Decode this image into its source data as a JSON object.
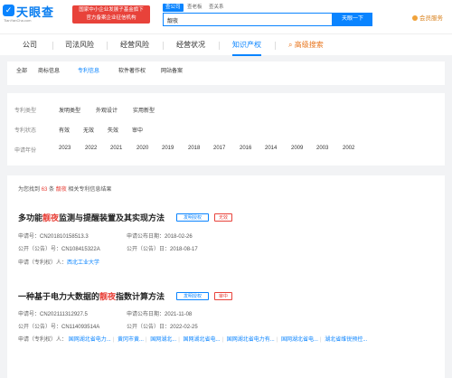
{
  "header": {
    "logo_text": "天眼查",
    "logo_sub": "TianYanCha.com",
    "gov_badge_line1": "国家中小企业发展子基金旗下",
    "gov_badge_line2": "官方备案企业征信机构",
    "search_tabs": [
      "查公司",
      "查老板",
      "查关系"
    ],
    "search_value": "靓夜",
    "search_button": "天眼一下",
    "vip_label": "会员服务"
  },
  "main_nav": {
    "items": [
      "公司",
      "司法风险",
      "经营风险",
      "经营状况",
      "知识产权",
      "高级搜索"
    ]
  },
  "sub_tabs": [
    "全部",
    "商标信息",
    "专利信息",
    "软件著作权",
    "网站备案"
  ],
  "filters": {
    "type_label": "专利类型",
    "type_options": [
      "发明类型",
      "外观设计",
      "实用新型"
    ],
    "status_label": "专利状态",
    "status_options": [
      "有效",
      "无效",
      "失效",
      "审中"
    ],
    "year_label": "申请年份",
    "year_options": [
      "2023",
      "2022",
      "2021",
      "2020",
      "2019",
      "2018",
      "2017",
      "2016",
      "2014",
      "2009",
      "2003",
      "2002"
    ]
  },
  "summary": {
    "prefix": "为您找到",
    "count": "63",
    "middle": "条",
    "keyword": "靓夜",
    "suffix": "相关专利信息结果"
  },
  "results": [
    {
      "title_before": "多功能",
      "title_highlight": "靓夜",
      "title_after": "监测与提醒装置及其实现方法",
      "tag_type": "发明授权",
      "tag_status": "无效",
      "app_no_label": "申请号：",
      "app_no": "CN201810158513.3",
      "pub_date_label": "申请公布日期：",
      "pub_date": "2018-02-26",
      "pub_no_label": "公开（公告）号：",
      "pub_no": "CN108415322A",
      "pub_day_label": "公开（公告）日：",
      "pub_day": "2018-08-17",
      "applicant_label": "申请（专利权）人：",
      "applicant": "西北工业大学"
    },
    {
      "title_before": "一种基于电力大数据的",
      "title_highlight": "靓夜",
      "title_after": "指数计算方法",
      "tag_type": "发明授权",
      "tag_status": "审中",
      "app_no_label": "申请号：",
      "app_no": "CN202111312927.5",
      "pub_date_label": "申请公布日期：",
      "pub_date": "2021-11-08",
      "pub_no_label": "公开（公告）号：",
      "pub_no": "CN114093514A",
      "pub_day_label": "公开（公告）日：",
      "pub_day": "2022-02-25",
      "applicant_label": "申请（专利权）人：",
      "applicants": [
        "国网湖北省电力...",
        "黄冈市黄...",
        "国网湖北...",
        "国网湖北省电...",
        "国网湖北省电力有...",
        "国网湖北省电...",
        "湖北省维锐预控..."
      ]
    }
  ],
  "colors": {
    "primary": "#0a84ff",
    "highlight": "#e8423a",
    "accent": "#e8761e"
  }
}
